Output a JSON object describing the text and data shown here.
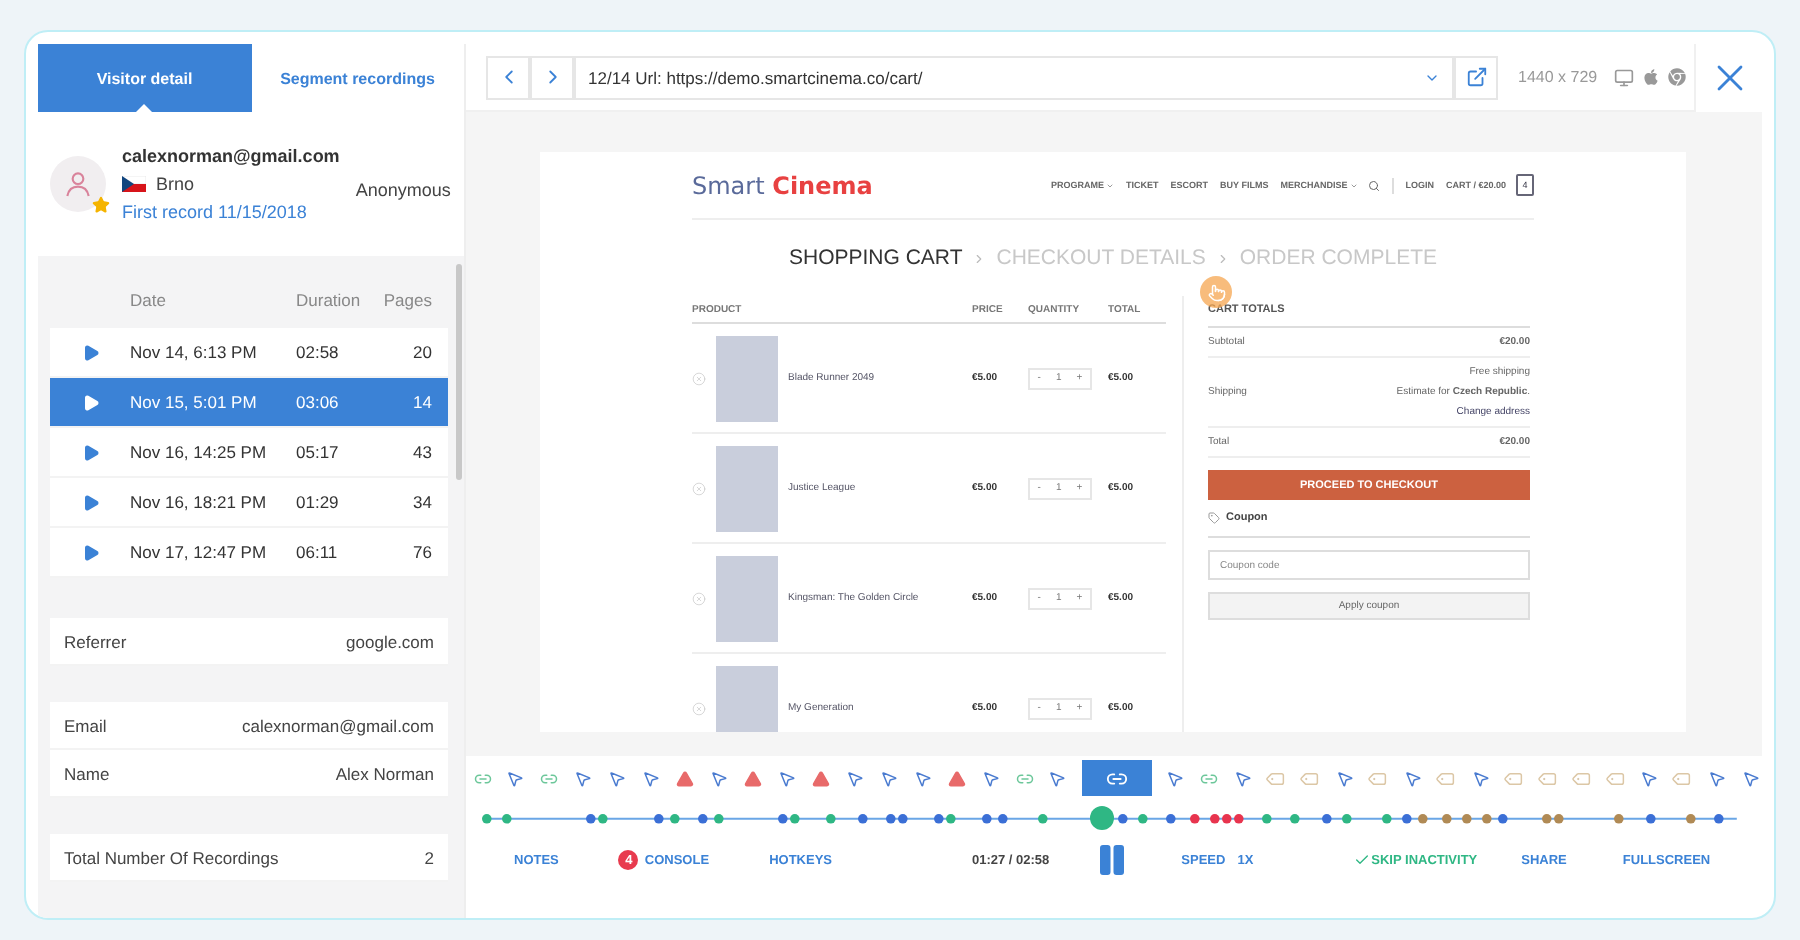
{
  "tabs": [
    {
      "label": "Visitor detail",
      "selected": true
    },
    {
      "label": "Segment recordings",
      "selected": false
    }
  ],
  "visitor": {
    "email": "calexnorman@gmail.com",
    "city": "Brno",
    "first_record": "First record 11/15/2018",
    "status": "Anonymous",
    "starred": true
  },
  "recordings": {
    "columns": [
      "Date",
      "Duration",
      "Pages"
    ],
    "rows": [
      {
        "date": "Nov 14, 6:13 PM",
        "duration": "02:58",
        "pages": "20",
        "selected": false
      },
      {
        "date": "Nov 15, 5:01 PM",
        "duration": "03:06",
        "pages": "14",
        "selected": true
      },
      {
        "date": "Nov 16, 14:25 PM",
        "duration": "05:17",
        "pages": "43",
        "selected": false
      },
      {
        "date": "Nov 16, 18:21 PM",
        "duration": "01:29",
        "pages": "34",
        "selected": false
      },
      {
        "date": "Nov 17, 12:47 PM",
        "duration": "06:11",
        "pages": "76",
        "selected": false
      }
    ]
  },
  "info_groups": [
    [
      {
        "label": "Referrer",
        "value": "google.com"
      }
    ],
    [
      {
        "label": "Email",
        "value": "calexnorman@gmail.com"
      },
      {
        "label": "Name",
        "value": "Alex Norman"
      }
    ],
    [
      {
        "label": "Total Number Of Recordings",
        "value": "2"
      }
    ]
  ],
  "toolbar": {
    "url": "12/14 Url: https://demo.smartcinema.co/cart/",
    "resolution": "1440 x 729"
  },
  "site": {
    "logo_first": "Smart",
    "logo_second": "Cinema",
    "nav": [
      {
        "label": "PROGRAME",
        "dropdown": true
      },
      {
        "label": "TICKET",
        "dropdown": false
      },
      {
        "label": "ESCORT",
        "dropdown": false
      },
      {
        "label": "BUY FILMS",
        "dropdown": false
      },
      {
        "label": "MERCHANDISE",
        "dropdown": true
      }
    ],
    "login": "LOGIN",
    "cart": "CART / €20.00",
    "cart_count": "4",
    "steps": [
      {
        "label": "SHOPPING CART",
        "selected": true
      },
      {
        "label": "CHECKOUT DETAILS",
        "selected": false
      },
      {
        "label": "ORDER COMPLETE",
        "selected": false
      }
    ],
    "columns": [
      "PRODUCT",
      "PRICE",
      "QUANTITY",
      "TOTAL"
    ],
    "qty_minus": "-",
    "qty_plus": "+",
    "products": [
      {
        "name": "Blade Runner 2049",
        "price": "€5.00",
        "quantity": "1",
        "total": "€5.00"
      },
      {
        "name": "Justice League",
        "price": "€5.00",
        "quantity": "1",
        "total": "€5.00"
      },
      {
        "name": "Kingsman: The Golden Circle",
        "price": "€5.00",
        "quantity": "1",
        "total": "€5.00"
      },
      {
        "name": "My Generation",
        "price": "€5.00",
        "quantity": "1",
        "total": "€5.00"
      }
    ],
    "totals_title": "CART TOTALS",
    "subtotal": {
      "label": "Subtotal",
      "value": "€20.00"
    },
    "shipping": {
      "label": "Shipping",
      "lines": [
        "Free shipping",
        "Estimate for **Czech Republic**."
      ],
      "link": "Change address"
    },
    "total": {
      "label": "Total",
      "value": "€20.00"
    },
    "checkout": "PROCEED TO CHECKOUT",
    "coupon_title": "Coupon",
    "coupon_placeholder": "Coupon code",
    "coupon_button": "Apply coupon"
  },
  "events": [
    {
      "kind": "link",
      "selected": false
    },
    {
      "kind": "click",
      "selected": false
    },
    {
      "kind": "link",
      "selected": false
    },
    {
      "kind": "click",
      "selected": false
    },
    {
      "kind": "click",
      "selected": false
    },
    {
      "kind": "click",
      "selected": false
    },
    {
      "kind": "error",
      "selected": false
    },
    {
      "kind": "click",
      "selected": false
    },
    {
      "kind": "error",
      "selected": false
    },
    {
      "kind": "click",
      "selected": false
    },
    {
      "kind": "error",
      "selected": false
    },
    {
      "kind": "click",
      "selected": false
    },
    {
      "kind": "click",
      "selected": false
    },
    {
      "kind": "click",
      "selected": false
    },
    {
      "kind": "error",
      "selected": false
    },
    {
      "kind": "click",
      "selected": false
    },
    {
      "kind": "link",
      "selected": false
    },
    {
      "kind": "click",
      "selected": false
    },
    {
      "kind": "link",
      "selected": true
    },
    {
      "kind": "click",
      "selected": false
    },
    {
      "kind": "link",
      "selected": false
    },
    {
      "kind": "click",
      "selected": false
    },
    {
      "kind": "input",
      "selected": false
    },
    {
      "kind": "input",
      "selected": false
    },
    {
      "kind": "click",
      "selected": false
    },
    {
      "kind": "input",
      "selected": false
    },
    {
      "kind": "click",
      "selected": false
    },
    {
      "kind": "input",
      "selected": false
    },
    {
      "kind": "click",
      "selected": false
    },
    {
      "kind": "input",
      "selected": false
    },
    {
      "kind": "input",
      "selected": false
    },
    {
      "kind": "input",
      "selected": false
    },
    {
      "kind": "input",
      "selected": false
    },
    {
      "kind": "click",
      "selected": false
    },
    {
      "kind": "input",
      "selected": false
    },
    {
      "kind": "click",
      "selected": false
    },
    {
      "kind": "click",
      "selected": false
    }
  ],
  "player": {
    "level": 0.49,
    "playing": true,
    "time": "01:27 / 02:58",
    "left_controls": [
      {
        "label": "NOTES"
      },
      {
        "label": "CONSOLE",
        "badge": "4"
      },
      {
        "label": "HOTKEYS"
      }
    ],
    "speed_label": "SPEED",
    "speed": "1X",
    "skip": {
      "label": "SKIP INACTIVITY",
      "on": true
    },
    "right_controls": [
      {
        "label": "SHARE"
      },
      {
        "label": "FULLSCREEN"
      }
    ]
  }
}
